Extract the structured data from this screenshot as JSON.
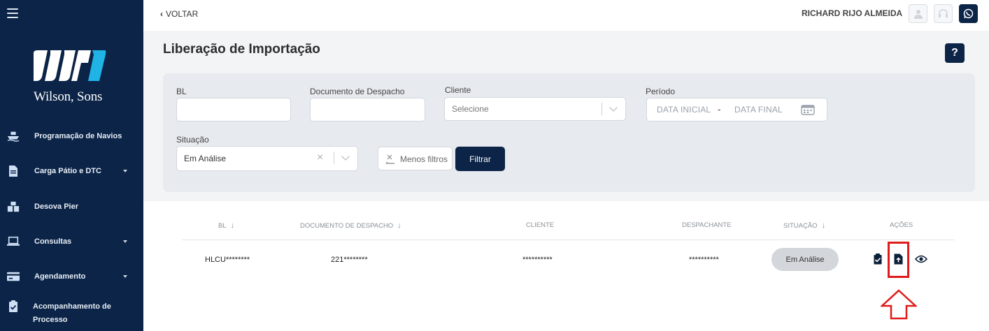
{
  "sidebar": {
    "brand": "Wilson, Sons",
    "items": [
      {
        "label": "Programação de Navios",
        "icon": "ship-icon",
        "has_submenu": false
      },
      {
        "label": "Carga Pátio e DTC",
        "icon": "document-icon",
        "has_submenu": true
      },
      {
        "label": "Desova Pier",
        "icon": "boxes-icon",
        "has_submenu": false
      },
      {
        "label": "Consultas",
        "icon": "laptop-icon",
        "has_submenu": true
      },
      {
        "label": "Agendamento",
        "icon": "card-icon",
        "has_submenu": true
      },
      {
        "label": "Acompanhamento de Processo",
        "label_line1": "Acompanhamento de",
        "label_line2": "Processo",
        "icon": "clipboard-check-icon",
        "has_submenu": false
      }
    ]
  },
  "header": {
    "back_label": "VOLTAR",
    "user_name": "RICHARD RIJO ALMEIDA",
    "buttons": [
      "user-icon",
      "headset-icon",
      "whatsapp-icon"
    ]
  },
  "page": {
    "title": "Liberação de Importação",
    "help_label": "?"
  },
  "filters": {
    "bl": {
      "label": "BL",
      "value": ""
    },
    "documento": {
      "label": "Documento de Despacho",
      "value": ""
    },
    "cliente": {
      "label": "Cliente",
      "placeholder": "Selecione"
    },
    "periodo": {
      "label": "Período",
      "start_placeholder": "DATA INICIAL",
      "separator": "-",
      "end_placeholder": "DATA FINAL"
    },
    "situacao": {
      "label": "Situação",
      "value": "Em Análise"
    },
    "less_filters_label": "Menos filtros",
    "filter_button_label": "Filtrar"
  },
  "table": {
    "columns": [
      {
        "label": "BL",
        "sortable": true
      },
      {
        "label": "DOCUMENTO DE DESPACHO",
        "sortable": true
      },
      {
        "label": "CLIENTE",
        "sortable": false
      },
      {
        "label": "DESPACHANTE",
        "sortable": false
      },
      {
        "label": "SITUAÇÃO",
        "sortable": true
      },
      {
        "label": "AÇÕES",
        "sortable": false
      }
    ],
    "rows": [
      {
        "bl": "HLCU********",
        "documento": "221********",
        "cliente": "**********",
        "despachante": "**********",
        "situacao": "Em Análise",
        "actions": [
          "clipboard-check-icon",
          "file-upload-icon",
          "eye-icon"
        ]
      }
    ]
  },
  "colors": {
    "sidebar_bg": "#0b2447",
    "panel_bg": "#e7eaee",
    "primary": "#0b2447",
    "highlight": "#e01b1b",
    "status_pill": "#d3d6da"
  }
}
